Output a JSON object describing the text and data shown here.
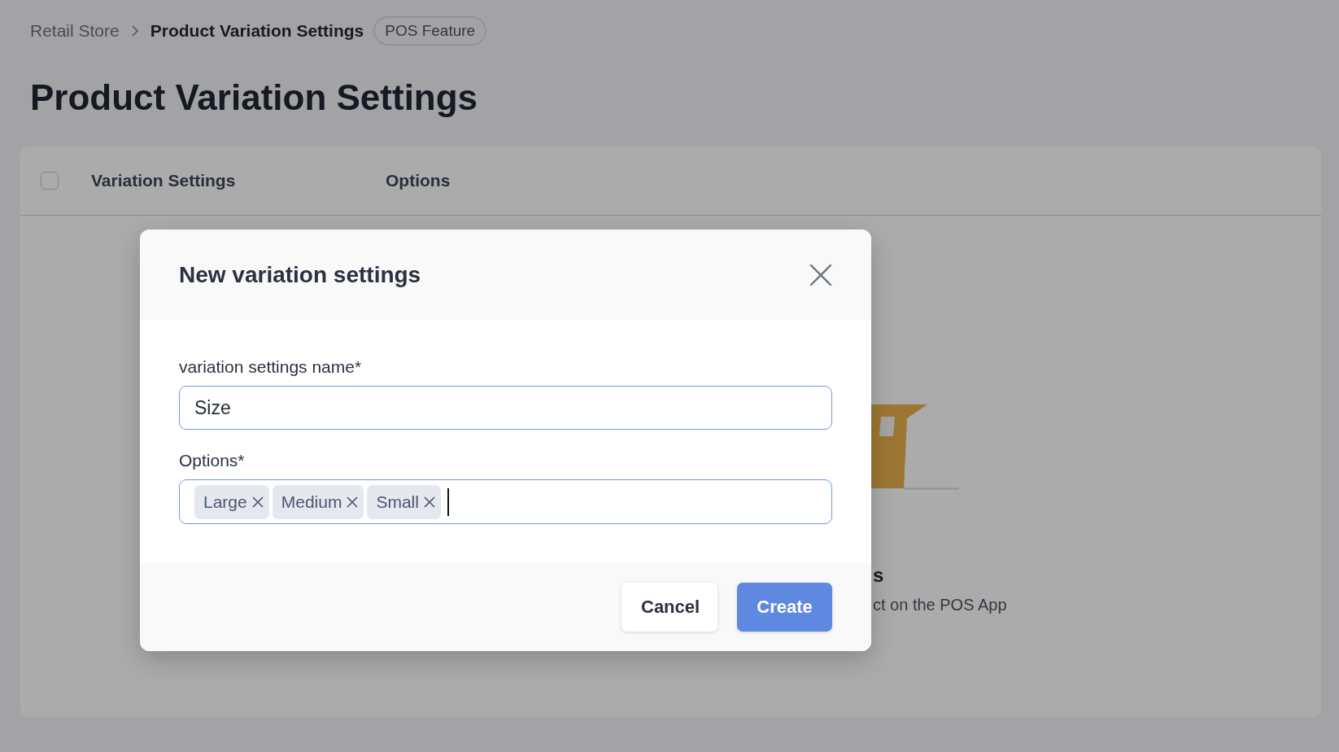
{
  "breadcrumb": {
    "items": [
      {
        "label": "Retail Store",
        "current": false
      },
      {
        "label": "Product Variation Settings",
        "current": true
      }
    ],
    "badge": "POS Feature"
  },
  "page_title": "Product Variation Settings",
  "table": {
    "select_all_checked": false,
    "columns": [
      "Variation Settings",
      "Options"
    ]
  },
  "empty_state": {
    "title": "s",
    "description": "ct on the POS App"
  },
  "modal": {
    "title": "New variation settings",
    "fields": [
      {
        "kind": "text",
        "label": "variation settings name*",
        "value": "Size"
      },
      {
        "kind": "tags",
        "label": "Options*",
        "tags": [
          "Large",
          "Medium",
          "Small"
        ]
      }
    ],
    "buttons": [
      {
        "label": "Cancel",
        "kind": "secondary"
      },
      {
        "label": "Create",
        "kind": "primary"
      }
    ]
  }
}
